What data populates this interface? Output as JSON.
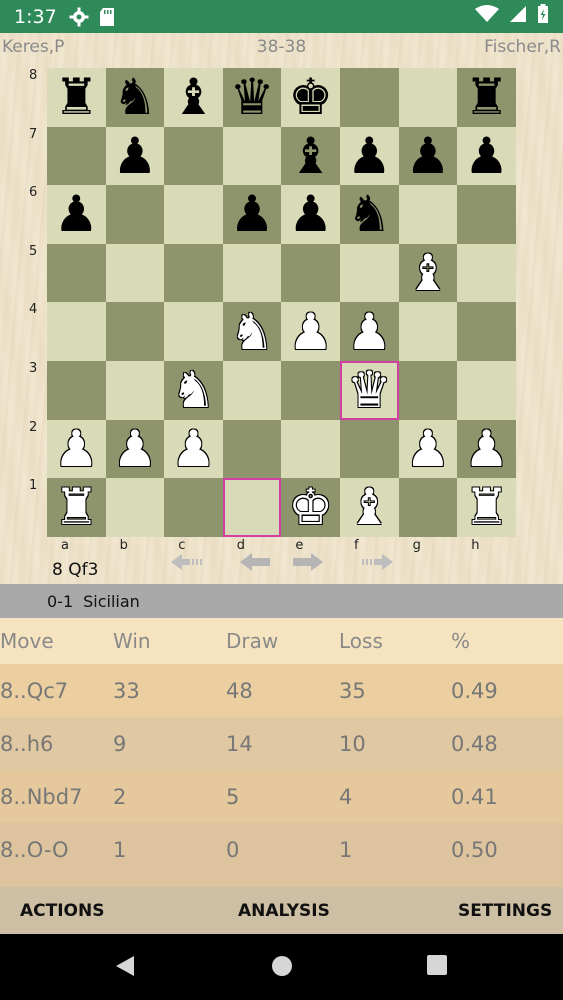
{
  "status": {
    "time": "1:37",
    "icons": [
      "gear-icon",
      "sd-card-icon",
      "wifi-icon",
      "signal-icon",
      "battery-icon"
    ]
  },
  "game": {
    "white_player": "Keres,P",
    "score": "38-38",
    "black_player": "Fischer,R",
    "current_move": "8 Qf3"
  },
  "board": {
    "ranks": [
      "8",
      "7",
      "6",
      "5",
      "4",
      "3",
      "2",
      "1"
    ],
    "files": [
      "a",
      "b",
      "c",
      "d",
      "e",
      "f",
      "g",
      "h"
    ],
    "highlight": [
      "f3",
      "d1"
    ],
    "pieces": {
      "a8": "bR",
      "b8": "bN",
      "c8": "bB",
      "d8": "bQ",
      "e8": "bK",
      "h8": "bR",
      "b7": "bP",
      "e7": "bB",
      "f7": "bP",
      "g7": "bP",
      "h7": "bP",
      "a6": "bP",
      "d6": "bP",
      "e6": "bP",
      "f6": "bN",
      "g5": "wB",
      "d4": "wN",
      "e4": "wP",
      "f4": "wP",
      "c3": "wN",
      "f3": "wQ",
      "a2": "wP",
      "b2": "wP",
      "c2": "wP",
      "g2": "wP",
      "h2": "wP",
      "a1": "wR",
      "e1": "wK",
      "f1": "wB",
      "h1": "wR"
    }
  },
  "opening": {
    "result": "0-1",
    "name": "Sicilian"
  },
  "stats": {
    "headers": [
      "Move",
      "Win",
      "Draw",
      "Loss",
      "%"
    ],
    "rows": [
      {
        "move": "8..Qc7",
        "win": "33",
        "draw": "48",
        "loss": "35",
        "pct": "0.49",
        "color": "#eccfa1"
      },
      {
        "move": "8..h6",
        "win": "9",
        "draw": "14",
        "loss": "10",
        "pct": "0.48",
        "color": "#e0c8a2"
      },
      {
        "move": "8..Nbd7",
        "win": "2",
        "draw": "5",
        "loss": "4",
        "pct": "0.41",
        "color": "#e5c89c"
      },
      {
        "move": "8..O-O",
        "win": "1",
        "draw": "0",
        "loss": "1",
        "pct": "0.50",
        "color": "#ddc49e"
      }
    ]
  },
  "actions": {
    "actions_label": "ACTIONS",
    "analysis_label": "ANALYSIS",
    "settings_label": "SETTINGS"
  }
}
